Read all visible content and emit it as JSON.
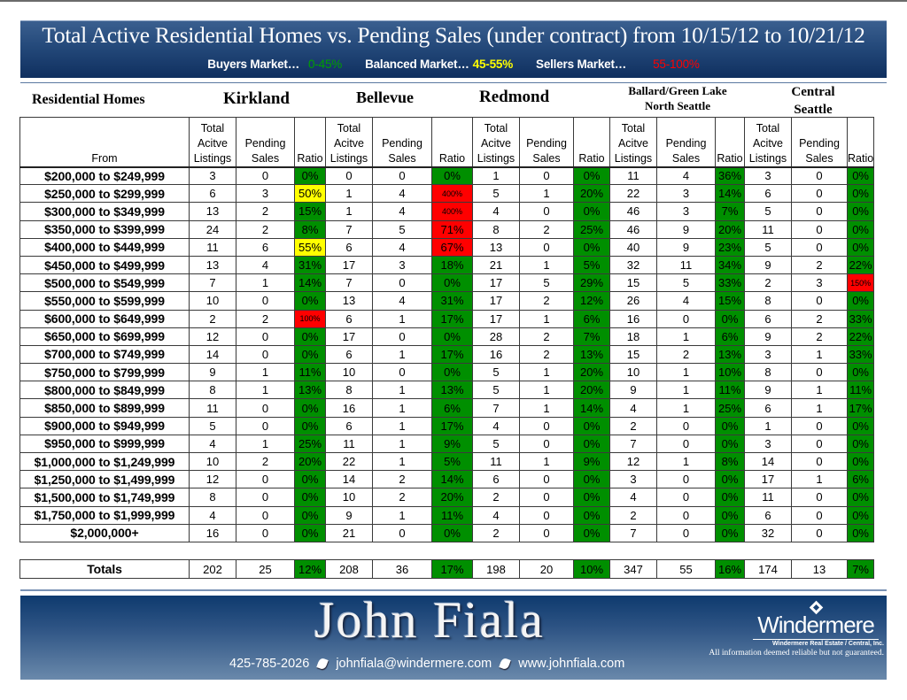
{
  "banner": {
    "title": "Total Active Residential Homes vs. Pending Sales (under contract) from 10/15/12 to 10/21/12",
    "legend": {
      "buyers_label": "Buyers Market…",
      "buyers_range": "0-45%",
      "balanced_label": "Balanced Market…",
      "balanced_range": "45-55%",
      "sellers_label": "Sellers Market…",
      "sellers_range": "55-100%"
    }
  },
  "colors": {
    "buyers": "#008f00",
    "balanced": "#ffff00",
    "sellers": "#ff0000",
    "banner_dark": "#0f2f5f"
  },
  "section_label": "Residential Homes",
  "cities": {
    "kirkland": "Kirkland",
    "bellevue": "Bellevue",
    "redmond": "Redmond",
    "ballard_line1": "Ballard/Green Lake",
    "ballard_line2": "North Seattle",
    "central_line1": "Central",
    "central_line2": "Seattle"
  },
  "table": {
    "header": {
      "from": "From",
      "total_l1": "Total",
      "total_l2": "Acitve",
      "total_l3": "Listings",
      "pending_l1": "Pending",
      "pending_l2": "Sales",
      "ratio": "Ratio"
    },
    "rows": [
      {
        "label": "$200,000 to $249,999",
        "cells": [
          [
            "3",
            "0",
            "0%",
            "g"
          ],
          [
            "0",
            "0",
            "0%",
            "g"
          ],
          [
            "1",
            "0",
            "0%",
            "g"
          ],
          [
            "11",
            "4",
            "36%",
            "g"
          ],
          [
            "3",
            "0",
            "0%",
            "g"
          ]
        ]
      },
      {
        "label": "$250,000 to $299,999",
        "cells": [
          [
            "6",
            "3",
            "50%",
            "y"
          ],
          [
            "1",
            "4",
            "400%",
            "r"
          ],
          [
            "5",
            "1",
            "20%",
            "g"
          ],
          [
            "22",
            "3",
            "14%",
            "g"
          ],
          [
            "6",
            "0",
            "0%",
            "g"
          ]
        ]
      },
      {
        "label": "$300,000 to $349,999",
        "cells": [
          [
            "13",
            "2",
            "15%",
            "g"
          ],
          [
            "1",
            "4",
            "400%",
            "r"
          ],
          [
            "4",
            "0",
            "0%",
            "g"
          ],
          [
            "46",
            "3",
            "7%",
            "g"
          ],
          [
            "5",
            "0",
            "0%",
            "g"
          ]
        ]
      },
      {
        "label": "$350,000 to $399,999",
        "cells": [
          [
            "24",
            "2",
            "8%",
            "g"
          ],
          [
            "7",
            "5",
            "71%",
            "r"
          ],
          [
            "8",
            "2",
            "25%",
            "g"
          ],
          [
            "46",
            "9",
            "20%",
            "g"
          ],
          [
            "11",
            "0",
            "0%",
            "g"
          ]
        ]
      },
      {
        "label": "$400,000 to $449,999",
        "cells": [
          [
            "11",
            "6",
            "55%",
            "y"
          ],
          [
            "6",
            "4",
            "67%",
            "r"
          ],
          [
            "13",
            "0",
            "0%",
            "g"
          ],
          [
            "40",
            "9",
            "23%",
            "g"
          ],
          [
            "5",
            "0",
            "0%",
            "g"
          ]
        ]
      },
      {
        "label": "$450,000 to $499,999",
        "cells": [
          [
            "13",
            "4",
            "31%",
            "g"
          ],
          [
            "17",
            "3",
            "18%",
            "g"
          ],
          [
            "21",
            "1",
            "5%",
            "g"
          ],
          [
            "32",
            "11",
            "34%",
            "g"
          ],
          [
            "9",
            "2",
            "22%",
            "g"
          ]
        ]
      },
      {
        "label": "$500,000 to $549,999",
        "cells": [
          [
            "7",
            "1",
            "14%",
            "g"
          ],
          [
            "7",
            "0",
            "0%",
            "g"
          ],
          [
            "17",
            "5",
            "29%",
            "g"
          ],
          [
            "15",
            "5",
            "33%",
            "g"
          ],
          [
            "2",
            "3",
            "150%",
            "r"
          ]
        ]
      },
      {
        "label": "$550,000 to $599,999",
        "cells": [
          [
            "10",
            "0",
            "0%",
            "g"
          ],
          [
            "13",
            "4",
            "31%",
            "g"
          ],
          [
            "17",
            "2",
            "12%",
            "g"
          ],
          [
            "26",
            "4",
            "15%",
            "g"
          ],
          [
            "8",
            "0",
            "0%",
            "g"
          ]
        ]
      },
      {
        "label": "$600,000 to $649,999",
        "cells": [
          [
            "2",
            "2",
            "100%",
            "r"
          ],
          [
            "6",
            "1",
            "17%",
            "g"
          ],
          [
            "17",
            "1",
            "6%",
            "g"
          ],
          [
            "16",
            "0",
            "0%",
            "g"
          ],
          [
            "6",
            "2",
            "33%",
            "g"
          ]
        ]
      },
      {
        "label": "$650,000 to $699,999",
        "cells": [
          [
            "12",
            "0",
            "0%",
            "g"
          ],
          [
            "17",
            "0",
            "0%",
            "g"
          ],
          [
            "28",
            "2",
            "7%",
            "g"
          ],
          [
            "18",
            "1",
            "6%",
            "g"
          ],
          [
            "9",
            "2",
            "22%",
            "g"
          ]
        ]
      },
      {
        "label": "$700,000 to $749,999",
        "cells": [
          [
            "14",
            "0",
            "0%",
            "g"
          ],
          [
            "6",
            "1",
            "17%",
            "g"
          ],
          [
            "16",
            "2",
            "13%",
            "g"
          ],
          [
            "15",
            "2",
            "13%",
            "g"
          ],
          [
            "3",
            "1",
            "33%",
            "g"
          ]
        ]
      },
      {
        "label": "$750,000 to $799,999",
        "cells": [
          [
            "9",
            "1",
            "11%",
            "g"
          ],
          [
            "10",
            "0",
            "0%",
            "g"
          ],
          [
            "5",
            "1",
            "20%",
            "g"
          ],
          [
            "10",
            "1",
            "10%",
            "g"
          ],
          [
            "8",
            "0",
            "0%",
            "g"
          ]
        ]
      },
      {
        "label": "$800,000 to $849,999",
        "cells": [
          [
            "8",
            "1",
            "13%",
            "g"
          ],
          [
            "8",
            "1",
            "13%",
            "g"
          ],
          [
            "5",
            "1",
            "20%",
            "g"
          ],
          [
            "9",
            "1",
            "11%",
            "g"
          ],
          [
            "9",
            "1",
            "11%",
            "g"
          ]
        ]
      },
      {
        "label": "$850,000 to $899,999",
        "cells": [
          [
            "11",
            "0",
            "0%",
            "g"
          ],
          [
            "16",
            "1",
            "6%",
            "g"
          ],
          [
            "7",
            "1",
            "14%",
            "g"
          ],
          [
            "4",
            "1",
            "25%",
            "g"
          ],
          [
            "6",
            "1",
            "17%",
            "g"
          ]
        ]
      },
      {
        "label": "$900,000 to $949,999",
        "cells": [
          [
            "5",
            "0",
            "0%",
            "g"
          ],
          [
            "6",
            "1",
            "17%",
            "g"
          ],
          [
            "4",
            "0",
            "0%",
            "g"
          ],
          [
            "2",
            "0",
            "0%",
            "g"
          ],
          [
            "1",
            "0",
            "0%",
            "g"
          ]
        ]
      },
      {
        "label": "$950,000 to $999,999",
        "cells": [
          [
            "4",
            "1",
            "25%",
            "g"
          ],
          [
            "11",
            "1",
            "9%",
            "g"
          ],
          [
            "5",
            "0",
            "0%",
            "g"
          ],
          [
            "7",
            "0",
            "0%",
            "g"
          ],
          [
            "3",
            "0",
            "0%",
            "g"
          ]
        ]
      },
      {
        "label": "$1,000,000 to $1,249,999",
        "cells": [
          [
            "10",
            "2",
            "20%",
            "g"
          ],
          [
            "22",
            "1",
            "5%",
            "g"
          ],
          [
            "11",
            "1",
            "9%",
            "g"
          ],
          [
            "12",
            "1",
            "8%",
            "g"
          ],
          [
            "14",
            "0",
            "0%",
            "g"
          ]
        ]
      },
      {
        "label": "$1,250,000 to $1,499,999",
        "cells": [
          [
            "12",
            "0",
            "0%",
            "g"
          ],
          [
            "14",
            "2",
            "14%",
            "g"
          ],
          [
            "6",
            "0",
            "0%",
            "g"
          ],
          [
            "3",
            "0",
            "0%",
            "g"
          ],
          [
            "17",
            "1",
            "6%",
            "g"
          ]
        ]
      },
      {
        "label": "$1,500,000 to $1,749,999",
        "cells": [
          [
            "8",
            "0",
            "0%",
            "g"
          ],
          [
            "10",
            "2",
            "20%",
            "g"
          ],
          [
            "2",
            "0",
            "0%",
            "g"
          ],
          [
            "4",
            "0",
            "0%",
            "g"
          ],
          [
            "11",
            "0",
            "0%",
            "g"
          ]
        ]
      },
      {
        "label": "$1,750,000 to $1,999,999",
        "cells": [
          [
            "4",
            "0",
            "0%",
            "g"
          ],
          [
            "9",
            "1",
            "11%",
            "g"
          ],
          [
            "4",
            "0",
            "0%",
            "g"
          ],
          [
            "2",
            "0",
            "0%",
            "g"
          ],
          [
            "6",
            "0",
            "0%",
            "g"
          ]
        ]
      },
      {
        "label": "$2,000,000+",
        "cells": [
          [
            "16",
            "0",
            "0%",
            "g"
          ],
          [
            "21",
            "0",
            "0%",
            "g"
          ],
          [
            "2",
            "0",
            "0%",
            "g"
          ],
          [
            "7",
            "0",
            "0%",
            "g"
          ],
          [
            "32",
            "0",
            "0%",
            "g"
          ]
        ]
      }
    ],
    "totals": {
      "label": "Totals",
      "cells": [
        [
          "202",
          "25",
          "12%",
          "g"
        ],
        [
          "208",
          "36",
          "17%",
          "g"
        ],
        [
          "198",
          "20",
          "10%",
          "g"
        ],
        [
          "347",
          "55",
          "16%",
          "g"
        ],
        [
          "174",
          "13",
          "7%",
          "g"
        ]
      ]
    }
  },
  "footer": {
    "name": "John Fiala",
    "phone": "425-785-2026",
    "email": "johnfiala@windermere.com",
    "website": "www.johnfiala.com",
    "brand": "Windermere",
    "brand_sub": "Windermere Real Estate / Central, Inc.",
    "disclaimer": "All information deemed reliable but not guaranteed."
  }
}
